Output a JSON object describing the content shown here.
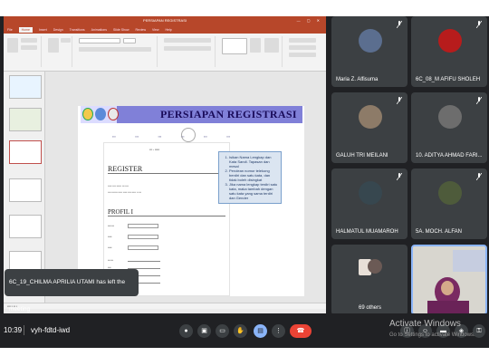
{
  "app": {
    "ppt_title": "PERSIAPAN REGISTRASI",
    "ribbon_tabs": [
      "File",
      "Home",
      "Insert",
      "Design",
      "Transitions",
      "Animations",
      "Slide Show",
      "Review",
      "View",
      "Help"
    ],
    "active_tab": "Home"
  },
  "slide": {
    "title": "PERSIAPAN REGISTRASI",
    "register_heading": "REGISTER",
    "profil_heading": "PROFIL I",
    "notes": [
      "Isikan Nama Lengkap dan Kata Sandi. Tapasan dan mesal",
      "Perolean nomor telekong berdiri dan satu kata, dan tidak boleh disingkat",
      "Jika nama lengkap terdiri satu kata, maka tambah dengan satu kata yang sama terdiri dan Gender"
    ]
  },
  "toast": "6C_19_CHILMA APRILIA UTAMI has left the meeting",
  "participants": [
    {
      "name": "Maria Z. Alfisuma",
      "color": "#5b6e8f"
    },
    {
      "name": "6C_08_M AFIFU SHOLEH",
      "color": "#b71c1c"
    },
    {
      "name": "GALUH TRI MEILANI",
      "color": "#8d7b68"
    },
    {
      "name": "10. ADITYA AHMAD FARI...",
      "color": "#6d6d6d"
    },
    {
      "name": "HALMATUL MUAMAROH",
      "color": "#37474f"
    },
    {
      "name": "5A. MOCH. ALFAN",
      "color": "#4e5b3b"
    },
    {
      "name": "69 others",
      "color": "#5f6368"
    }
  ],
  "bar": {
    "time": "10:39",
    "separator": "|",
    "meeting_code": "vyh-fdtd-iwd",
    "watermark_title": "Activate Windows",
    "watermark_sub": "Go to Settings to activate Windows."
  },
  "colors": {
    "ppt_accent": "#b7472a",
    "slide_band": "#8080d8",
    "end_call": "#ea4335",
    "active_control": "#8ab4f8"
  },
  "icons": {
    "controls": [
      "mic-icon",
      "camera-icon",
      "captions-icon",
      "hand-icon",
      "present-icon",
      "more-icon",
      "end-call-icon"
    ]
  }
}
